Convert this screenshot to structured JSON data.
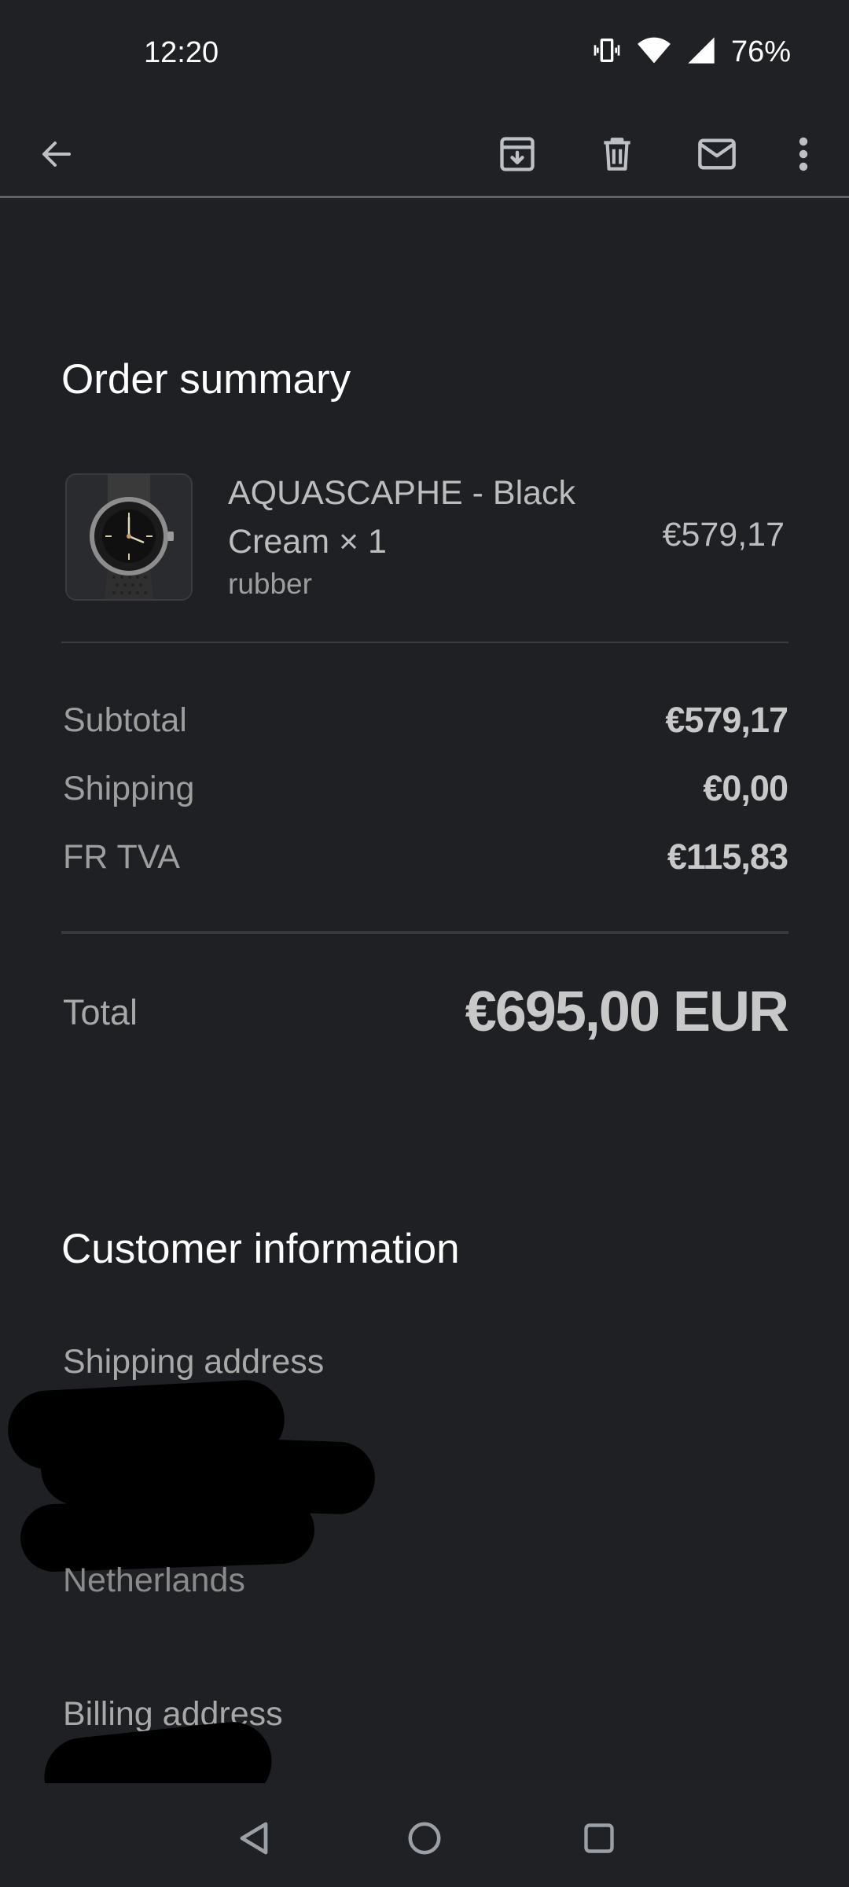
{
  "status_bar": {
    "time": "12:20",
    "battery": "76%",
    "icons": [
      "vibrate-icon",
      "wifi-icon",
      "signal-icon"
    ]
  },
  "toolbar": {
    "icons": [
      "back-arrow-icon",
      "archive-icon",
      "delete-icon",
      "mark-unread-icon",
      "more-vert-icon"
    ]
  },
  "order_summary": {
    "title": "Order summary",
    "product": {
      "name": "AQUASCAPHE - Black Cream × 1",
      "variant": "rubber",
      "price": "€579,17"
    },
    "rows": [
      {
        "label": "Subtotal",
        "value": "€579,17"
      },
      {
        "label": "Shipping",
        "value": "€0,00"
      },
      {
        "label": "FR TVA",
        "value": "€115,83"
      }
    ],
    "total_label": "Total",
    "total_value": "€695,00 EUR"
  },
  "customer_information": {
    "title": "Customer information",
    "shipping_address_label": "Shipping address",
    "shipping_country": "Netherlands",
    "billing_address_label": "Billing address"
  },
  "colors": {
    "background": "#202124",
    "text_primary": "#ffffff",
    "text_secondary": "#9e9e9e"
  },
  "nav_bar": {
    "icons": [
      "nav-back-icon",
      "nav-home-icon",
      "nav-recents-icon"
    ]
  }
}
